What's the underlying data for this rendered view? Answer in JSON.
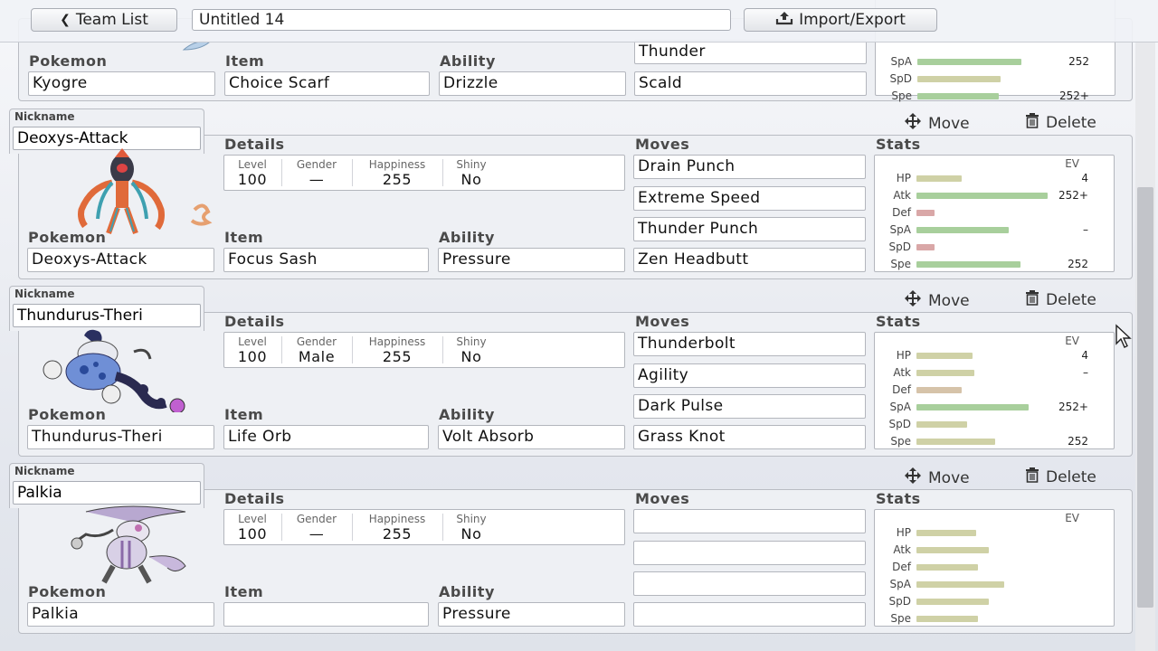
{
  "header": {
    "team_list_label": "Team List",
    "team_name": "Untitled 14",
    "import_export_label": "Import/Export"
  },
  "labels": {
    "nickname": "Nickname",
    "details": "Details",
    "moves": "Moves",
    "stats": "Stats",
    "pokemon": "Pokemon",
    "item": "Item",
    "ability": "Ability",
    "level": "Level",
    "gender": "Gender",
    "happiness": "Happiness",
    "shiny": "Shiny",
    "ev": "EV",
    "move_action": "Move",
    "delete_action": "Delete"
  },
  "partial_set": {
    "pokemon": "Kyogre",
    "item": "Choice Scarf",
    "ability": "Drizzle",
    "moves": [
      "Thunder",
      "Scald"
    ],
    "stats": [
      {
        "name": "SpA",
        "ev": "252"
      },
      {
        "name": "SpD",
        "ev": ""
      },
      {
        "name": "Spe",
        "ev": "252+"
      }
    ]
  },
  "sets": [
    {
      "nickname": "Deoxys-Attack",
      "pokemon": "Deoxys-Attack",
      "item": "Focus Sash",
      "ability": "Pressure",
      "level": "100",
      "gender": "—",
      "happiness": "255",
      "shiny": "No",
      "moves": [
        "Drain Punch",
        "Extreme Speed",
        "Thunder Punch",
        "Zen Headbutt"
      ],
      "stats": [
        {
          "name": "HP",
          "ev": "4"
        },
        {
          "name": "Atk",
          "ev": "252+"
        },
        {
          "name": "Def",
          "ev": ""
        },
        {
          "name": "SpA",
          "ev": "–"
        },
        {
          "name": "SpD",
          "ev": ""
        },
        {
          "name": "Spe",
          "ev": "252"
        }
      ]
    },
    {
      "nickname": "Thundurus-Theri",
      "pokemon": "Thundurus-Theri",
      "item": "Life Orb",
      "ability": "Volt Absorb",
      "level": "100",
      "gender": "Male",
      "happiness": "255",
      "shiny": "No",
      "moves": [
        "Thunderbolt",
        "Agility",
        "Dark Pulse",
        "Grass Knot"
      ],
      "stats": [
        {
          "name": "HP",
          "ev": "4"
        },
        {
          "name": "Atk",
          "ev": "–"
        },
        {
          "name": "Def",
          "ev": ""
        },
        {
          "name": "SpA",
          "ev": "252+"
        },
        {
          "name": "SpD",
          "ev": ""
        },
        {
          "name": "Spe",
          "ev": "252"
        }
      ]
    },
    {
      "nickname": "Palkia",
      "pokemon": "Palkia",
      "item": "",
      "ability": "Pressure",
      "level": "100",
      "gender": "—",
      "happiness": "255",
      "shiny": "No",
      "moves": [
        "",
        "",
        "",
        ""
      ],
      "stats": [
        {
          "name": "HP",
          "ev": ""
        },
        {
          "name": "Atk",
          "ev": ""
        },
        {
          "name": "Def",
          "ev": ""
        },
        {
          "name": "SpA",
          "ev": ""
        },
        {
          "name": "SpD",
          "ev": ""
        },
        {
          "name": "Spe",
          "ev": ""
        }
      ]
    }
  ],
  "colors": {
    "bar_green": "#a8cf9c",
    "bar_beige": "#cfd1a6",
    "bar_red": "#d9a7a7",
    "bar_tan": "#d6c3a9"
  }
}
